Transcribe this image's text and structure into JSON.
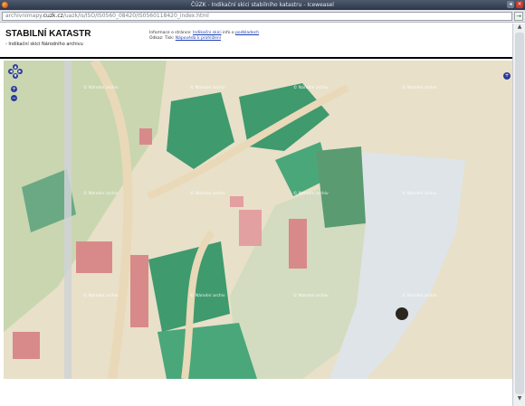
{
  "window": {
    "title": "ČÚZK - Indikační skici stabilního katastru - Iceweasel",
    "controls": [
      "◂",
      "×"
    ]
  },
  "address_bar": {
    "url_prefix": "archivnimapy.",
    "url_host": "cuzk.cz",
    "url_path": "/uazk/is/ISO/IS0560_08420/IS0560118420_index.html",
    "go_glyph": "→"
  },
  "page": {
    "title": "STABILNÍ KATASTR",
    "subtitle": "- Indikační skici Národního archivu",
    "info_line1_prefix": "Informace o stránce:",
    "info_link1": "Indikační skici",
    "info_mid": "info o",
    "info_link2": "podkladech",
    "info_line2_prefix": "Odkaz: Tisk:",
    "info_link3": "Nápověda k prohlížení"
  },
  "map": {
    "watermark_text": "© Národní archiv",
    "nav_icons": [
      "pan-arrows-icon",
      "zoom-in-icon",
      "zoom-out-icon",
      "layer-switcher-icon"
    ],
    "zoom_in_glyph": "+",
    "zoom_out_glyph": "−",
    "layer_switch_glyph": "+",
    "colors": {
      "paper": "#e8e0c8",
      "meadow": "#c9d6b0",
      "forest": "#3f9a6e",
      "buildings": "#d88a8a",
      "roads": "#e9d9b8",
      "water": "#dfe4e8"
    }
  },
  "scrollbar": {
    "up_glyph": "▲",
    "down_glyph": "▼"
  }
}
